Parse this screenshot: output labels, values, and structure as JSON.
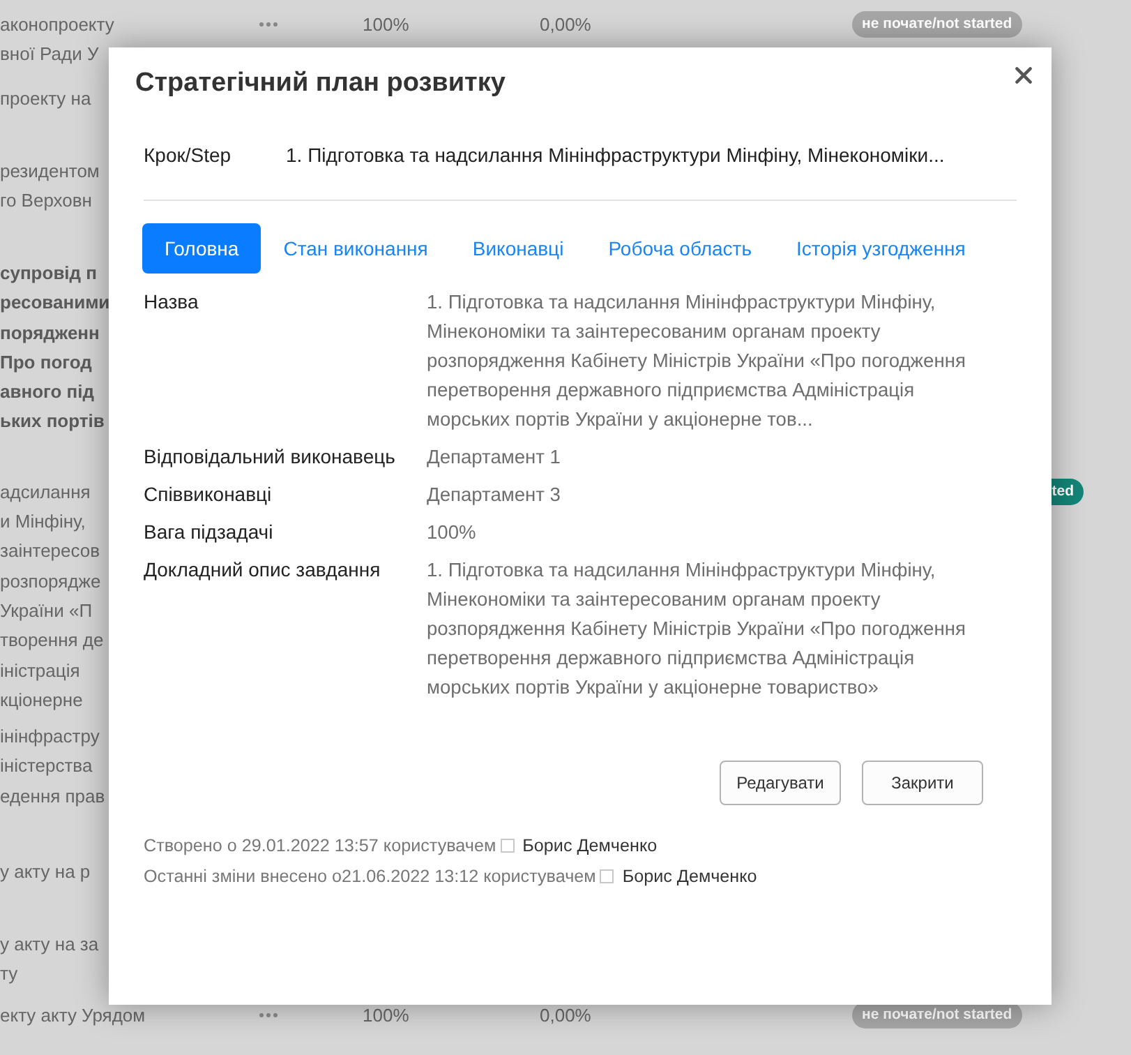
{
  "background_table": {
    "rows": [
      {
        "text_lines": [
          "аконопроекту",
          "вної Ради У"
        ],
        "bold": false,
        "more_button": true,
        "weight": "100%",
        "progress": "0,00%",
        "status": {
          "label": "не почате/not started",
          "kind": "not_started",
          "clipped": false
        }
      },
      {
        "text_lines": [
          "проекту на"
        ],
        "bold": false
      },
      {
        "text_lines": [
          "резидентом",
          "го Верховн"
        ],
        "bold": false
      },
      {
        "text_lines": [
          "супровід п",
          "ресованими",
          "порядженн",
          "Про погод",
          "авного під",
          "ьких портів"
        ],
        "bold": true
      },
      {
        "text_lines": [
          "адсилання",
          "и Мінфіну,",
          "заінтересов",
          "розпорядже",
          "України «П",
          "творення де",
          "іністрація",
          "кціонерне"
        ],
        "bold": false,
        "status": {
          "label": "ted",
          "kind": "started",
          "clipped": true
        }
      },
      {
        "text_lines": [
          "інінфрастру",
          "іністерства",
          "едення прав"
        ],
        "bold": false
      },
      {
        "text_lines": [
          "у акту на р"
        ],
        "bold": false
      },
      {
        "text_lines": [
          "у акту на за",
          "ту"
        ],
        "bold": false
      },
      {
        "text_lines": [
          "екту акту Урядом"
        ],
        "bold": false,
        "more_button": true,
        "weight": "100%",
        "progress": "0,00%",
        "status": {
          "label": "не почате/not started",
          "kind": "not_started",
          "clipped": false
        }
      }
    ]
  },
  "dialog": {
    "title": "Стратегічний план розвитку",
    "step": {
      "label": "Крок/Step",
      "value": "1. Підготовка та надсилання Мінінфраструктури Мінфіну, Мінекономіки..."
    },
    "tabs": [
      {
        "label": "Головна",
        "selected": true
      },
      {
        "label": "Стан виконання",
        "selected": false
      },
      {
        "label": "Виконавці",
        "selected": false
      },
      {
        "label": "Робоча область",
        "selected": false
      },
      {
        "label": "Історія узгодження",
        "selected": false
      }
    ],
    "fields": [
      {
        "label": "Назва",
        "value": "1. Підготовка та надсилання Мінінфраструктури Мінфіну, Мінекономіки та заінтересованим органам проекту розпорядження Кабінету Міністрів України «Про погодження перетворення державного підприємства Адміністрація морських портів України у акціонерне тов..."
      },
      {
        "label": "Відповідальний виконавець",
        "value": "Департамент 1"
      },
      {
        "label": "Співвиконавці",
        "value": "Департамент 3"
      },
      {
        "label": "Вага підзадачі",
        "value": "100%"
      },
      {
        "label": "Докладний опис завдання",
        "value": "1. Підготовка та надсилання Мінінфраструктури Мінфіну, Мінекономіки та заінтересованим органам проекту розпорядження Кабінету Міністрів України «Про погодження перетворення державного підприємства Адміністрація морських портів України у акціонерне товариство»"
      }
    ],
    "buttons": [
      {
        "label": "Редагувати"
      },
      {
        "label": "Закрити"
      }
    ],
    "audit": [
      {
        "text": "Створено о 29.01.2022 13:57 користувачем",
        "user": "Борис Демченко"
      },
      {
        "text": "Останні зміни внесено о21.06.2022 13:12 користувачем",
        "user": "Борис Демченко"
      }
    ]
  }
}
